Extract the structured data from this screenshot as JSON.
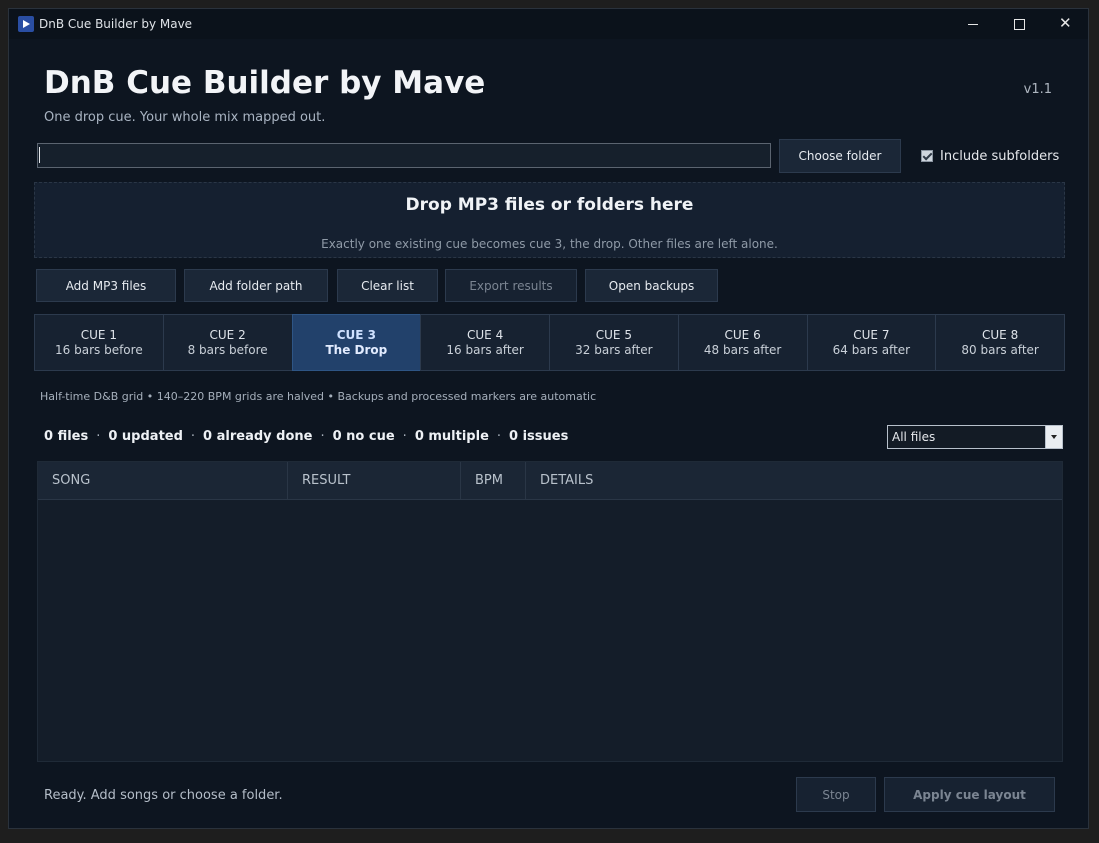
{
  "window": {
    "title": "DnB Cue Builder by Mave",
    "minimize_glyph": "",
    "maximize_glyph": "",
    "close_glyph": "✕"
  },
  "header": {
    "title": "DnB Cue Builder by Mave",
    "subtitle": "One drop cue. Your whole mix mapped out.",
    "version": "v1.1"
  },
  "path": {
    "value": "",
    "choose_label": "Choose folder",
    "include_subfolders_label": "Include subfolders",
    "include_subfolders_checked": true
  },
  "dropzone": {
    "title": "Drop MP3 files or folders here",
    "subtitle": "Exactly one existing cue becomes cue 3, the drop. Other files are left alone."
  },
  "actions": {
    "add_files": "Add MP3 files",
    "add_folder": "Add folder path",
    "clear": "Clear list",
    "export": "Export results",
    "backups": "Open backups"
  },
  "cues": [
    {
      "label": "CUE 1",
      "sub": "16 bars before",
      "active": false
    },
    {
      "label": "CUE 2",
      "sub": "8 bars before",
      "active": false
    },
    {
      "label": "CUE 3",
      "sub": "The Drop",
      "active": true
    },
    {
      "label": "CUE 4",
      "sub": "16 bars after",
      "active": false
    },
    {
      "label": "CUE 5",
      "sub": "32 bars after",
      "active": false
    },
    {
      "label": "CUE 6",
      "sub": "48 bars after",
      "active": false
    },
    {
      "label": "CUE 7",
      "sub": "64 bars after",
      "active": false
    },
    {
      "label": "CUE 8",
      "sub": "80 bars after",
      "active": false
    }
  ],
  "info_line": "Half-time D&B grid • 140–220 BPM grids are halved • Backups and processed markers are automatic",
  "stats": {
    "files": "0 files",
    "updated": "0 updated",
    "already_done": "0 already done",
    "no_cue": "0 no cue",
    "multiple": "0 multiple",
    "issues": "0 issues",
    "separator": "·"
  },
  "filter": {
    "selected": "All files"
  },
  "table": {
    "columns": [
      "SONG",
      "RESULT",
      "BPM",
      "DETAILS"
    ],
    "rows": []
  },
  "footer": {
    "status": "Ready. Add songs or choose a folder.",
    "stop_label": "Stop",
    "apply_label": "Apply cue layout"
  },
  "colors": {
    "background": "#0d1520",
    "accent_active_cue": "#22416b",
    "button": "#1b2737"
  }
}
